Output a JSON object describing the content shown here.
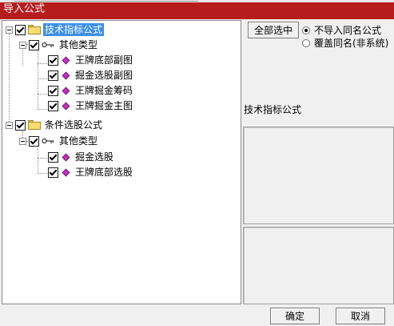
{
  "window": {
    "title": "导入公式"
  },
  "tree": {
    "root1": {
      "label": "技术指标公式",
      "group": {
        "label": "其他类型",
        "items": [
          "王牌底部副图",
          "掘金选股副图",
          "王牌掘金筹码",
          "王牌掘金主图"
        ]
      }
    },
    "root2": {
      "label": "条件选股公式",
      "group": {
        "label": "其他类型",
        "items": [
          "掘金选股",
          "王牌底部选股"
        ]
      }
    }
  },
  "side": {
    "select_all": "全部选中",
    "options": [
      "不导入同名公式",
      "覆盖同名(非系统)"
    ],
    "selected_option": 0,
    "description_title": "技术指标公式"
  },
  "footer": {
    "ok": "确定",
    "cancel": "取消"
  },
  "colors": {
    "titlebar": "#b71c1c",
    "selection": "#3b8fe6",
    "formula_icon": "#c82fbe"
  }
}
